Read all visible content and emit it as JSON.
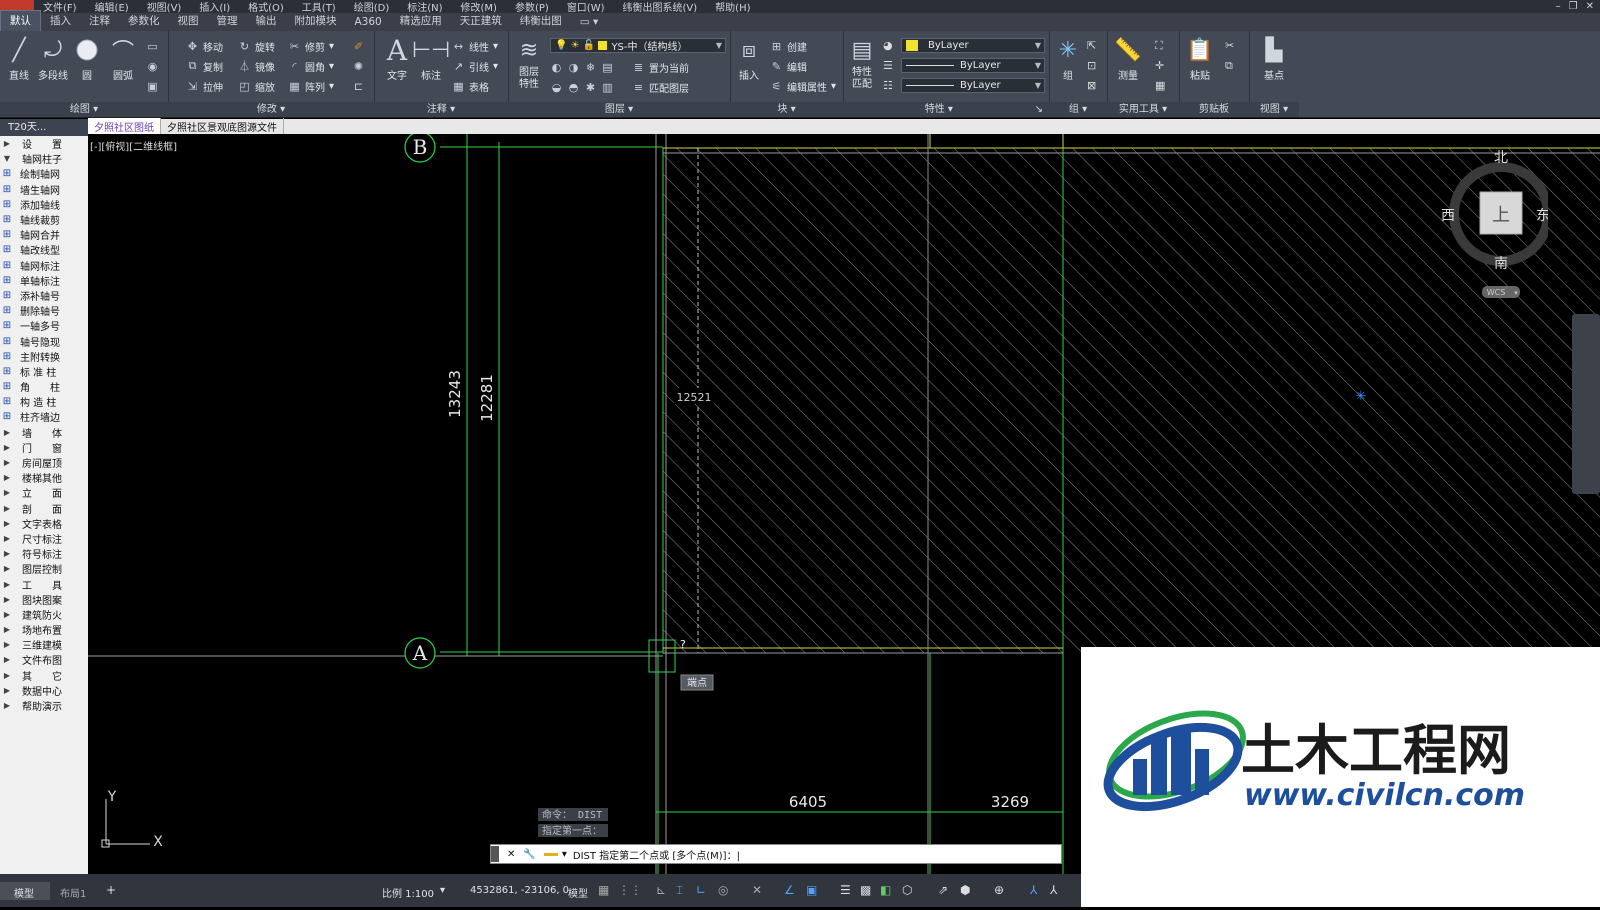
{
  "menu": {
    "items": [
      "文件(F)",
      "编辑(E)",
      "视图(V)",
      "插入(I)",
      "格式(O)",
      "工具(T)",
      "绘图(D)",
      "标注(N)",
      "修改(M)",
      "参数(P)",
      "窗口(W)",
      "纬衡出图系统(V)",
      "帮助(H)"
    ]
  },
  "ribbon_tabs": [
    "默认",
    "插入",
    "注释",
    "参数化",
    "视图",
    "管理",
    "输出",
    "附加模块",
    "A360",
    "精选应用",
    "天正建筑",
    "纬衡出图"
  ],
  "ribbon": {
    "draw": {
      "title": "绘图",
      "line": "直线",
      "polyline": "多段线",
      "circle": "圆",
      "arc": "圆弧"
    },
    "modify": {
      "title": "修改",
      "move": "移动",
      "rotate": "旋转",
      "trim": "修剪",
      "copy": "复制",
      "mirror": "镜像",
      "fillet": "圆角",
      "stretch": "拉伸",
      "scale": "缩放",
      "array": "阵列"
    },
    "annotation": {
      "title": "注释",
      "text": "文字",
      "dimension": "标注",
      "linear": "线性",
      "leader": "引线",
      "table": "表格"
    },
    "layers": {
      "title": "图层",
      "layer_props": "图层特性",
      "current_layer": "YS-中（结构线）",
      "set_current": "置为当前",
      "match_layer": "匹配图层"
    },
    "block": {
      "title": "块",
      "insert": "插入",
      "create": "创建",
      "edit": "编辑",
      "edit_attr": "编辑属性"
    },
    "properties": {
      "title": "特性",
      "match": "特性匹配",
      "color": "ByLayer",
      "linetype": "ByLayer",
      "lineweight": "ByLayer"
    },
    "group": {
      "title": "组",
      "group": "组"
    },
    "utilities": {
      "title": "实用工具",
      "measure": "测量"
    },
    "clipboard": {
      "title": "剪贴板",
      "paste": "粘贴"
    },
    "view": {
      "title": "视图",
      "base": "基点"
    }
  },
  "palette": {
    "header": "T20天...",
    "items": [
      {
        "label": "设　　置",
        "type": "cat"
      },
      {
        "label": "轴网柱子",
        "type": "cat-open"
      },
      {
        "label": "绘制轴网",
        "type": "cmd"
      },
      {
        "label": "墙生轴网",
        "type": "cmd"
      },
      {
        "label": "添加轴线",
        "type": "cmd"
      },
      {
        "label": "轴线裁剪",
        "type": "cmd"
      },
      {
        "label": "轴网合并",
        "type": "cmd"
      },
      {
        "label": "轴改线型",
        "type": "cmd"
      },
      {
        "label": "轴网标注",
        "type": "cmd"
      },
      {
        "label": "单轴标注",
        "type": "cmd"
      },
      {
        "label": "添补轴号",
        "type": "cmd"
      },
      {
        "label": "删除轴号",
        "type": "cmd"
      },
      {
        "label": "一轴多号",
        "type": "cmd"
      },
      {
        "label": "轴号隐现",
        "type": "cmd"
      },
      {
        "label": "主附转换",
        "type": "cmd"
      },
      {
        "label": "标 准 柱",
        "type": "cmd"
      },
      {
        "label": "角　　柱",
        "type": "cmd"
      },
      {
        "label": "构 造 柱",
        "type": "cmd"
      },
      {
        "label": "柱齐墙边",
        "type": "cmd"
      },
      {
        "label": "墙　　体",
        "type": "cat"
      },
      {
        "label": "门　　窗",
        "type": "cat"
      },
      {
        "label": "房间屋顶",
        "type": "cat"
      },
      {
        "label": "楼梯其他",
        "type": "cat"
      },
      {
        "label": "立　　面",
        "type": "cat"
      },
      {
        "label": "剖　　面",
        "type": "cat"
      },
      {
        "label": "文字表格",
        "type": "cat"
      },
      {
        "label": "尺寸标注",
        "type": "cat"
      },
      {
        "label": "符号标注",
        "type": "cat"
      },
      {
        "label": "图层控制",
        "type": "cat"
      },
      {
        "label": "工　　具",
        "type": "cat"
      },
      {
        "label": "图块图案",
        "type": "cat"
      },
      {
        "label": "建筑防火",
        "type": "cat"
      },
      {
        "label": "场地布置",
        "type": "cat"
      },
      {
        "label": "三维建模",
        "type": "cat"
      },
      {
        "label": "文件布图",
        "type": "cat"
      },
      {
        "label": "其　　它",
        "type": "cat"
      },
      {
        "label": "数据中心",
        "type": "cat"
      },
      {
        "label": "帮助演示",
        "type": "cat"
      }
    ]
  },
  "doc_tabs": [
    "夕照社区图纸",
    "夕照社区景观底图源文件"
  ],
  "viewport": {
    "label": "[-][俯视][二维线框]",
    "axis_b": "B",
    "axis_a": "A",
    "dim_13243": "13243",
    "dim_12281": "12281",
    "dim_12521": "12521",
    "dim_6405": "6405",
    "dim_3269": "3269",
    "snap_tooltip": "端点",
    "ucs_y": "Y",
    "ucs_x": "X"
  },
  "viewcube": {
    "north": "北",
    "south": "南",
    "west": "西",
    "east": "东",
    "top": "上",
    "wcs": "WCS"
  },
  "command": {
    "history1": "命令： DIST",
    "history2": "指定第一点：",
    "prompt": "DIST 指定第二个点或 [多个点(M)]：|"
  },
  "statusbar": {
    "tab_model": "模型",
    "tab_layout": "布局1",
    "add": "+",
    "scale": "比例 1:100",
    "coords": "4532861, -23106, 0",
    "space": "模型"
  },
  "watermark": {
    "title": "土木工程网",
    "url": "www.civilcn.com"
  },
  "colors": {
    "ribbon_bg": "#434a56",
    "drawing_green": "#2fd34a",
    "hatch": "#7a7a7a",
    "logo_blue": "#1e4f9c",
    "logo_green": "#2aa84a"
  }
}
